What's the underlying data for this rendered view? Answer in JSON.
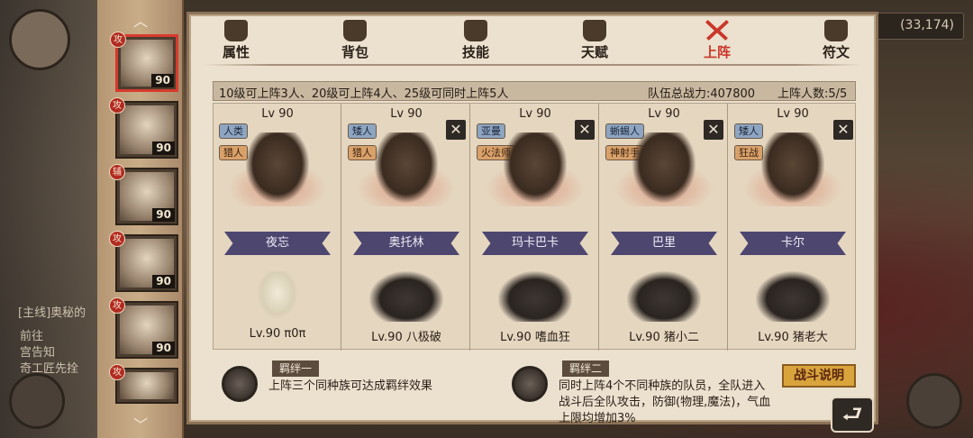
{
  "background": {
    "left_texts": [
      "[主线]奥秘的",
      "前往",
      "宫告知",
      "奇工匠先拴"
    ],
    "coordinates": "(33,174)"
  },
  "hero_strip": {
    "up_arrow": "︿",
    "down_arrow": "﹀",
    "slots": [
      {
        "badge": "攻",
        "level": "90",
        "selected": true
      },
      {
        "badge": "攻",
        "level": "90",
        "selected": false
      },
      {
        "badge": "辅",
        "level": "90",
        "selected": false
      },
      {
        "badge": "攻",
        "level": "90",
        "selected": false
      },
      {
        "badge": "攻",
        "level": "90",
        "selected": false
      },
      {
        "badge": "攻",
        "level": "",
        "selected": false
      }
    ]
  },
  "tabs": [
    {
      "label": "属性",
      "icon": "flame-icon"
    },
    {
      "label": "背包",
      "icon": "bag-icon"
    },
    {
      "label": "技能",
      "icon": "book-icon"
    },
    {
      "label": "天赋",
      "icon": "eye-icon"
    },
    {
      "label": "上阵",
      "icon": "crossed-swords-icon",
      "active": true
    },
    {
      "label": "符文",
      "icon": "rune-icon"
    }
  ],
  "info_bar": {
    "rule": "10级可上阵3人、20级可上阵4人、25级可同时上阵5人",
    "power": "队伍总战力:407800",
    "count": "上阵人数:5/5"
  },
  "team": [
    {
      "level": "Lv 90",
      "race": "人类",
      "cls": "猎人",
      "name": "夜忘",
      "pet": "Lv.90 π0π",
      "closable": false,
      "pet_kind": "egg"
    },
    {
      "level": "Lv 90",
      "race": "矮人",
      "cls": "猎人",
      "name": "奥托林",
      "pet": "Lv.90 八极破",
      "closable": true,
      "pet_kind": "beast"
    },
    {
      "level": "Lv 90",
      "race": "亚曼",
      "cls": "火法师",
      "name": "玛卡巴卡",
      "pet": "Lv.90 嗜血狂",
      "closable": true,
      "pet_kind": "beast"
    },
    {
      "level": "Lv 90",
      "race": "蜥蜴人",
      "cls": "神射手",
      "name": "巴里",
      "pet": "Lv.90 猪小二",
      "closable": true,
      "pet_kind": "boar"
    },
    {
      "level": "Lv 90",
      "race": "矮人",
      "cls": "狂战",
      "name": "卡尔",
      "pet": "Lv.90 猪老大",
      "closable": true,
      "pet_kind": "boar"
    }
  ],
  "bonds": [
    {
      "title": "羁绊一",
      "desc": [
        "上阵三个同种族可达成羁绊效果"
      ]
    },
    {
      "title": "羁绊二",
      "desc": [
        "同时上阵4个不同种族的队员，全队进入",
        "战斗后全队攻击，防御(物理,魔法)，气血",
        "上限均增加3%"
      ]
    }
  ],
  "buttons": {
    "battle_info": "战斗说明",
    "close": "✕",
    "return": "⮐"
  }
}
